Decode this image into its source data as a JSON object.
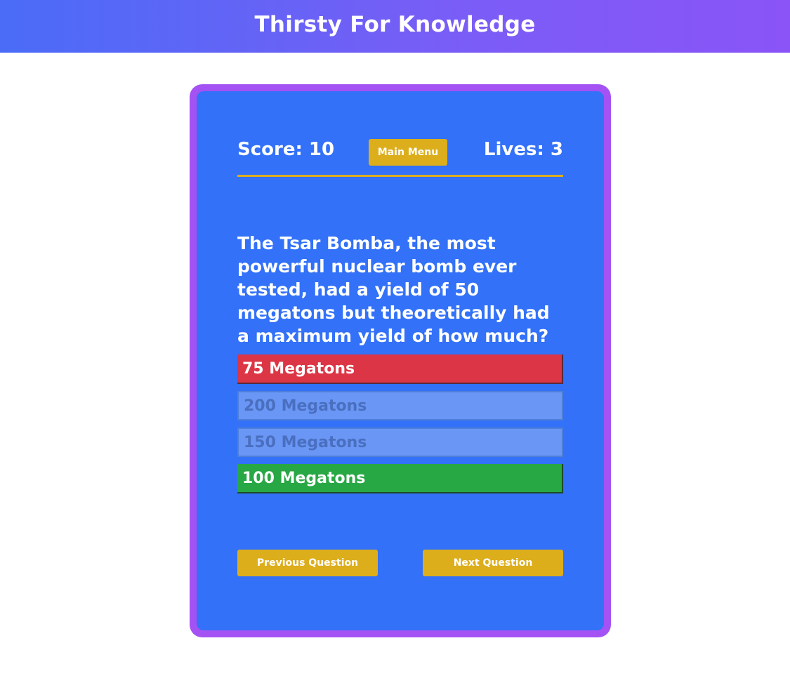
{
  "header": {
    "title": "Thirsty For Knowledge"
  },
  "status": {
    "score_label": "Score: 10",
    "lives_label": "Lives: 3",
    "menu_button": "Main Menu"
  },
  "question": {
    "text": "The Tsar Bomba, the most powerful nuclear bomb ever tested, had a yield of 50 megatons but theoretically had a maximum yield of how much?"
  },
  "answers": [
    {
      "label": "75 Megatons",
      "state": "wrong"
    },
    {
      "label": "200 Megatons",
      "state": "disabled"
    },
    {
      "label": "150 Megatons",
      "state": "disabled"
    },
    {
      "label": "100 Megatons",
      "state": "correct"
    }
  ],
  "navigation": {
    "previous_label": "Previous Question",
    "next_label": "Next Question"
  },
  "colors": {
    "card_border": "#a452f3",
    "card_background": "#3271f8",
    "accent": "#ddae1c",
    "wrong": "#dc3545",
    "correct": "#28a745",
    "disabled": "#6a97f6"
  }
}
